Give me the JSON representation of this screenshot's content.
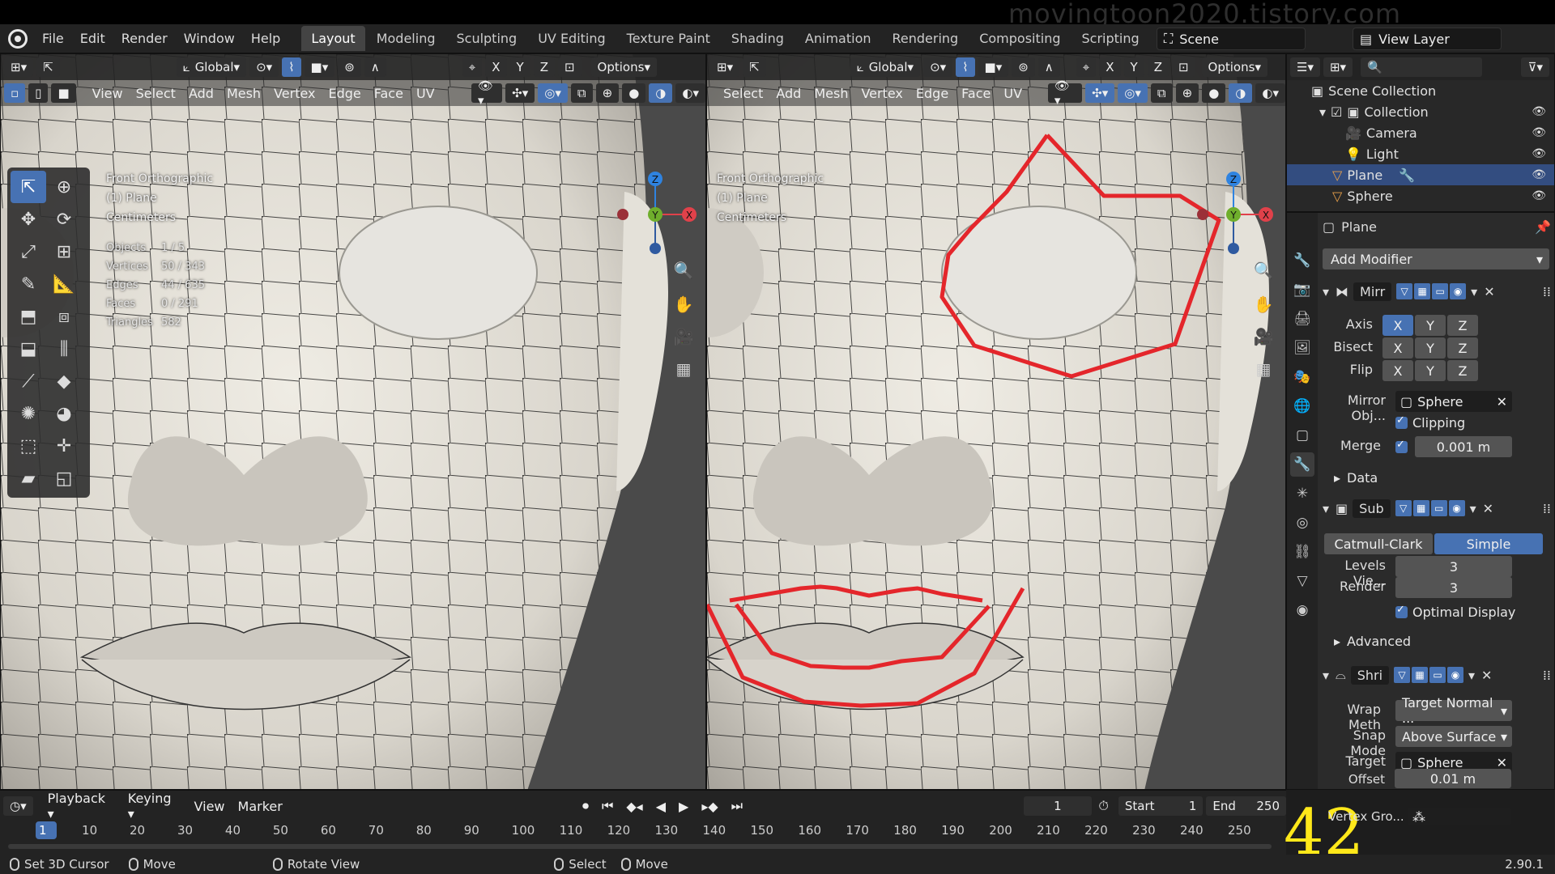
{
  "watermark": "movingtoon2020.tistory.com",
  "menus": [
    "File",
    "Edit",
    "Render",
    "Window",
    "Help"
  ],
  "workspaces": [
    {
      "label": "Layout",
      "active": true
    },
    {
      "label": "Modeling",
      "active": false
    },
    {
      "label": "Sculpting",
      "active": false
    },
    {
      "label": "UV Editing",
      "active": false
    },
    {
      "label": "Texture Paint",
      "active": false
    },
    {
      "label": "Shading",
      "active": false
    },
    {
      "label": "Animation",
      "active": false
    },
    {
      "label": "Rendering",
      "active": false
    },
    {
      "label": "Compositing",
      "active": false
    },
    {
      "label": "Scripting",
      "active": false
    }
  ],
  "add_workspace": "+",
  "scene": {
    "label": "Scene"
  },
  "view_layer": {
    "label": "View Layer"
  },
  "viewport": {
    "transform": "Global",
    "options": "Options",
    "axes": [
      "X",
      "Y",
      "Z"
    ],
    "menu": [
      "View",
      "Select",
      "Add",
      "Mesh",
      "Vertex",
      "Edge",
      "Face",
      "UV"
    ],
    "menu_right": [
      "Select",
      "Add",
      "Mesh",
      "Vertex",
      "Edge",
      "Face",
      "UV"
    ],
    "info": [
      "Front Orthographic",
      "(1) Plane",
      "Centimeters"
    ],
    "stats": [
      {
        "label": "Objects",
        "value": "1 / 5"
      },
      {
        "label": "Vertices",
        "value": "50 / 343"
      },
      {
        "label": "Edges",
        "value": "44 / 635"
      },
      {
        "label": "Faces",
        "value": "0 / 291"
      },
      {
        "label": "Triangles",
        "value": "582"
      }
    ],
    "gizmo": {
      "x": "X",
      "y": "Y",
      "z": "Z"
    },
    "colors": {
      "x": "#e0414a",
      "y": "#6fae2c",
      "z": "#2f83e0",
      "annotation": "#e4262b"
    }
  },
  "outliner": {
    "rows": [
      {
        "label": "Scene Collection",
        "selected": false
      },
      {
        "label": "Collection",
        "selected": false
      },
      {
        "label": "Camera",
        "selected": false
      },
      {
        "label": "Light",
        "selected": false
      },
      {
        "label": "Plane",
        "selected": true
      },
      {
        "label": "Sphere",
        "selected": false
      }
    ]
  },
  "properties": {
    "object": "Plane",
    "add_modifier": "Add Modifier",
    "mirror": {
      "name": "Mirr",
      "axis_label": "Axis",
      "bisect_label": "Bisect",
      "flip_label": "Flip",
      "axis": [
        "X",
        "Y",
        "Z"
      ],
      "mirror_obj_label": "Mirror Obj...",
      "mirror_obj": "Sphere",
      "clipping": "Clipping",
      "merge_label": "Merge",
      "merge_value": "0.001 m",
      "data": "Data"
    },
    "subsurf": {
      "name": "Sub",
      "catmull": "Catmull-Clark",
      "simple": "Simple",
      "levels_label": "Levels Vie...",
      "levels_value": "3",
      "render_label": "Render",
      "render_value": "3",
      "optimal": "Optimal Display",
      "advanced": "Advanced"
    },
    "shrink": {
      "name": "Shri",
      "wrap_label": "Wrap Meth",
      "wrap_value": "Target Normal ...",
      "snap_label": "Snap Mode",
      "snap_value": "Above Surface",
      "target_label": "Target",
      "target_value": "Sphere",
      "offset_label": "Offset",
      "offset_value": "0.01 m",
      "vgroup_label": "Vertex Gro..."
    }
  },
  "timeline": {
    "playback": "Playback",
    "keying": "Keying",
    "view": "View",
    "marker": "Marker",
    "current_frame": "1",
    "start_label": "Start",
    "start": "1",
    "end_label": "End",
    "end": "250",
    "ticks": [
      "1",
      "10",
      "20",
      "30",
      "40",
      "50",
      "60",
      "70",
      "80",
      "90",
      "100",
      "110",
      "120",
      "130",
      "140",
      "150",
      "160",
      "170",
      "180",
      "190",
      "200",
      "210",
      "220",
      "230",
      "240",
      "250"
    ]
  },
  "page_number": "42",
  "status": {
    "items": [
      "Set 3D Cursor",
      "Move",
      "Rotate View",
      "Select",
      "Move"
    ],
    "version": "2.90.1"
  }
}
